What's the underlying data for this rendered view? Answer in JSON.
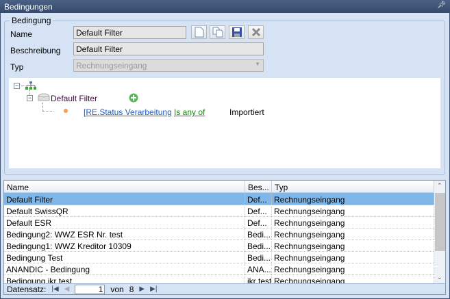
{
  "window": {
    "title": "Bedingungen",
    "pin_icon": "pin-icon"
  },
  "group": {
    "title": "Bedingung",
    "name_label": "Name",
    "name_value": "Default Filter",
    "desc_label": "Beschreibung",
    "desc_value": "Default Filter",
    "type_label": "Typ",
    "type_value": "Rechnungseingang"
  },
  "tree": {
    "root_node": "Default Filter",
    "condition": {
      "field": "[RE.Status Verarbeitung",
      "operator": "Is any of",
      "value": "Importiert"
    }
  },
  "grid": {
    "columns": [
      "Name",
      "Bes...",
      "Typ"
    ],
    "rows": [
      [
        "Default Filter",
        "Def...",
        "Rechnungseingang"
      ],
      [
        "Default SwissQR",
        "Def...",
        "Rechnungseingang"
      ],
      [
        "Default ESR",
        "Def...",
        "Rechnungseingang"
      ],
      [
        "Bedingung2: WWZ ESR Nr. test",
        "Bedi...",
        "Rechnungseingang"
      ],
      [
        "Bedingung1: WWZ Kreditor 10309",
        "Bedi...",
        "Rechnungseingang"
      ],
      [
        "Bedingung Test",
        "Bedi...",
        "Rechnungseingang"
      ],
      [
        "ANANDIC - Bedingung",
        "ANA...",
        "Rechnungseingang"
      ],
      [
        "Bedingung jkr test",
        "jkr test",
        "Rechnungseingang"
      ]
    ],
    "selected_index": 0
  },
  "footer": {
    "label": "Datensatz:",
    "current": "1",
    "of": "von",
    "total": "8"
  }
}
